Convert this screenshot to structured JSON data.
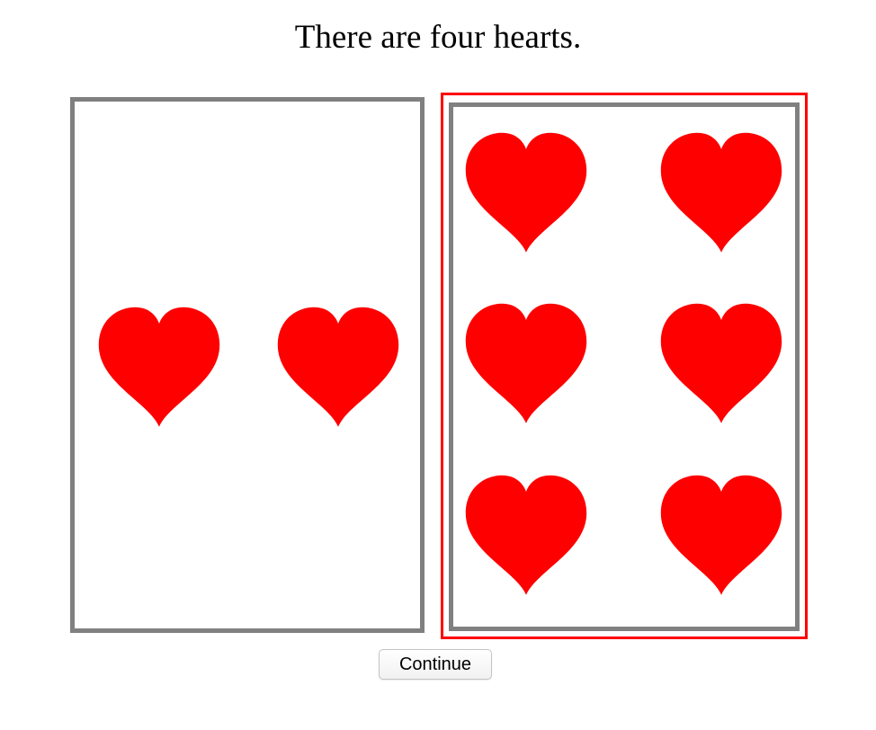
{
  "prompt": {
    "text": "There are four hearts."
  },
  "cards": [
    {
      "heart_count": 2,
      "selected": false
    },
    {
      "heart_count": 6,
      "selected": true
    }
  ],
  "colors": {
    "heart": "#ff0000",
    "card_border": "#808080",
    "selection_border": "#ff0000"
  },
  "icons": {
    "heart": "heart-icon"
  },
  "continue_button": {
    "label": "Continue"
  }
}
